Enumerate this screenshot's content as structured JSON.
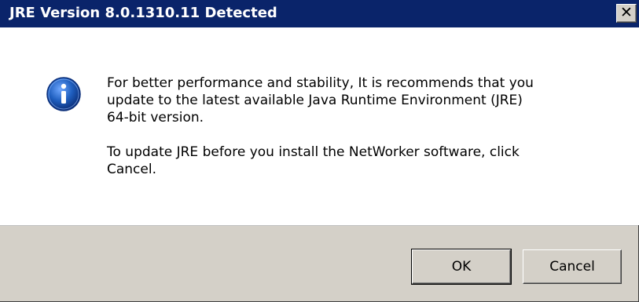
{
  "window": {
    "title": "JRE Version 8.0.1310.11 Detected",
    "close_label": "✕"
  },
  "message": {
    "icon": "info-icon",
    "paragraph1": "For better performance and stability, It is recommends that you\nupdate to the latest available Java Runtime Environment (JRE)\n64-bit version.",
    "paragraph2": "To update JRE before you install the NetWorker software, click\nCancel."
  },
  "buttons": {
    "ok_label": "OK",
    "cancel_label": "Cancel"
  },
  "colors": {
    "titlebar": "#0a246a",
    "dialog_face": "#d4d0c8",
    "icon_blue": "#1f5fbf"
  }
}
